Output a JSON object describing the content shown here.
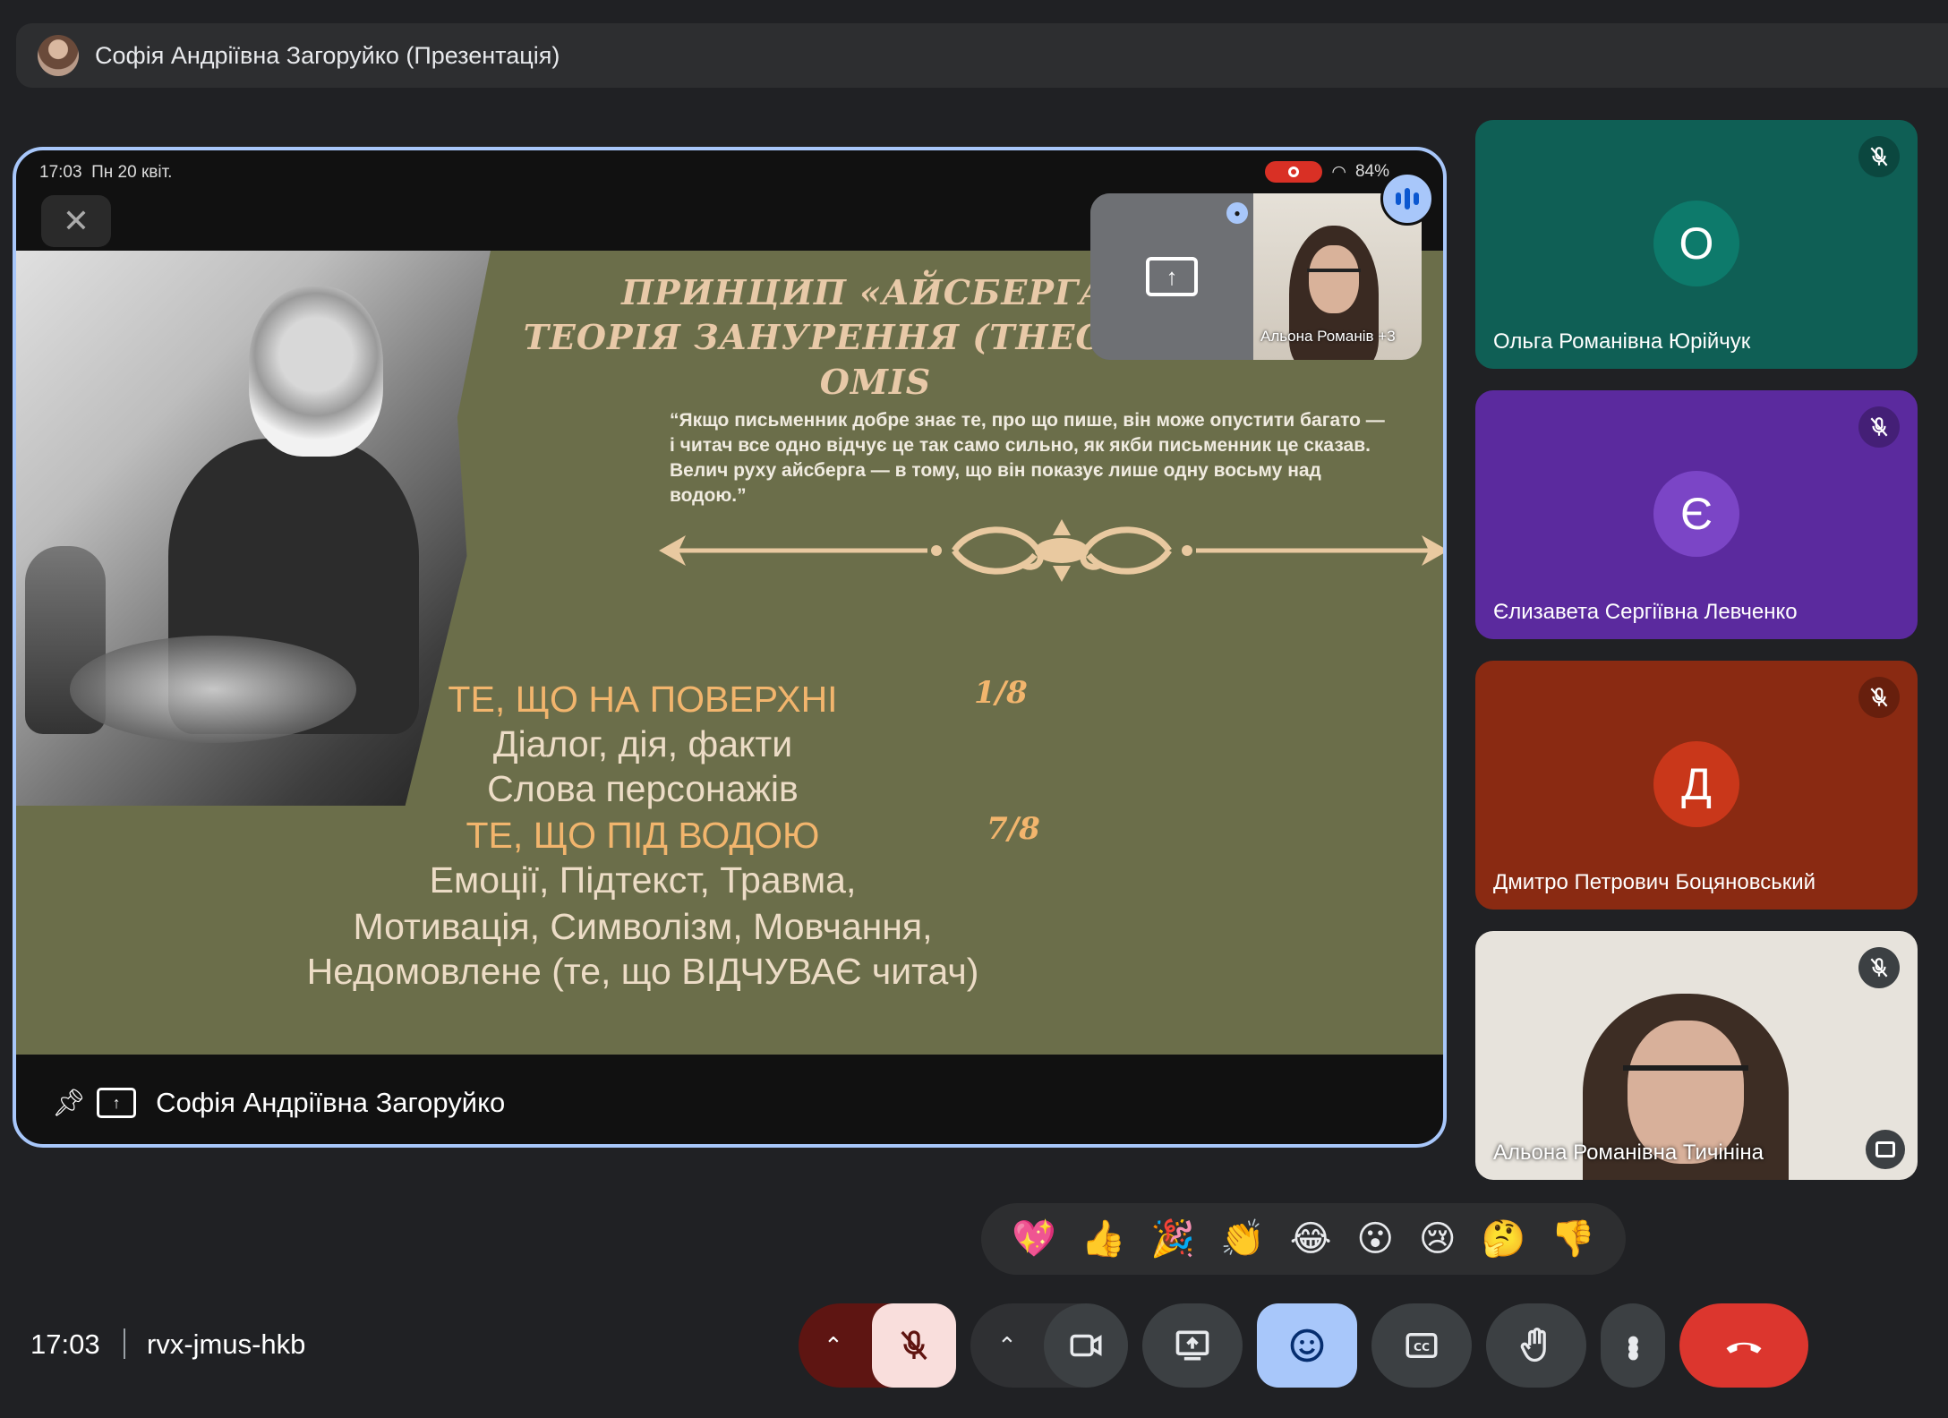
{
  "topbar": {
    "title": "Софія Андріївна Загоруйко (Презентація)"
  },
  "device_status": {
    "time_date": "17:03  Пн 20 квіт.",
    "battery": "84%"
  },
  "slide": {
    "title": "ПРИНЦИП «АЙСБЕРГА»\nТЕОРІЯ ЗАНУРЕННЯ (THEORY OF OMIS",
    "quote": "“Якщо письменник добре знає те, про що пише, він може опустити багато — і читач все одно відчує це так само сильно, як якби письменник це сказав. Велич руху айсберга — в тому, що він показує лише одну восьму над водою.”",
    "surface_heading": "ТЕ, ЩО НА ПОВЕРХНІ",
    "surface_fraction": "1/8",
    "surface_line1": "Діалог, дія, факти",
    "surface_line2": "Слова персонажів",
    "under_heading": "ТЕ, ЩО ПІД ВОДОЮ",
    "under_fraction": "7/8",
    "under_line1": "Емоції, Підтекст, Травма,",
    "under_line2": "Мотивація, Символізм, Мовчання,",
    "under_line3": "Недомовлене (те, що ВІДЧУВАЄ читач)"
  },
  "pip": {
    "name": "Альона Романів",
    "extra": "+3"
  },
  "stage_footer": {
    "presenter": "Софія Андріївна Загоруйко"
  },
  "participants": [
    {
      "initial": "О",
      "name": "Ольга Романівна Юрійчук",
      "bg": "#0f5f55",
      "avatar": "#0d7a6b"
    },
    {
      "initial": "Є",
      "name": "Єлизавета Сергіївна Левченко",
      "bg": "#5b2a9e",
      "avatar": "#7b45c6"
    },
    {
      "initial": "Д",
      "name": "Дмитро Петрович Боцяновський",
      "bg": "#8a2a12",
      "avatar": "#c9371a"
    },
    {
      "initial": "",
      "name": "Альона Романівна Тичініна",
      "bg": "#e7e3dc",
      "avatar": ""
    }
  ],
  "reactions": [
    "💖",
    "👍",
    "🎉",
    "👏",
    "😂",
    "😮",
    "😢",
    "🤔",
    "👎"
  ],
  "bottombar": {
    "time": "17:03",
    "meeting_code": "rvx-jmus-hkb"
  },
  "colors": {
    "accent": "#a8c7fa",
    "end_call": "#dc362e",
    "mic_off": "#f9dedc",
    "slide_bg": "#6b6e4a"
  }
}
